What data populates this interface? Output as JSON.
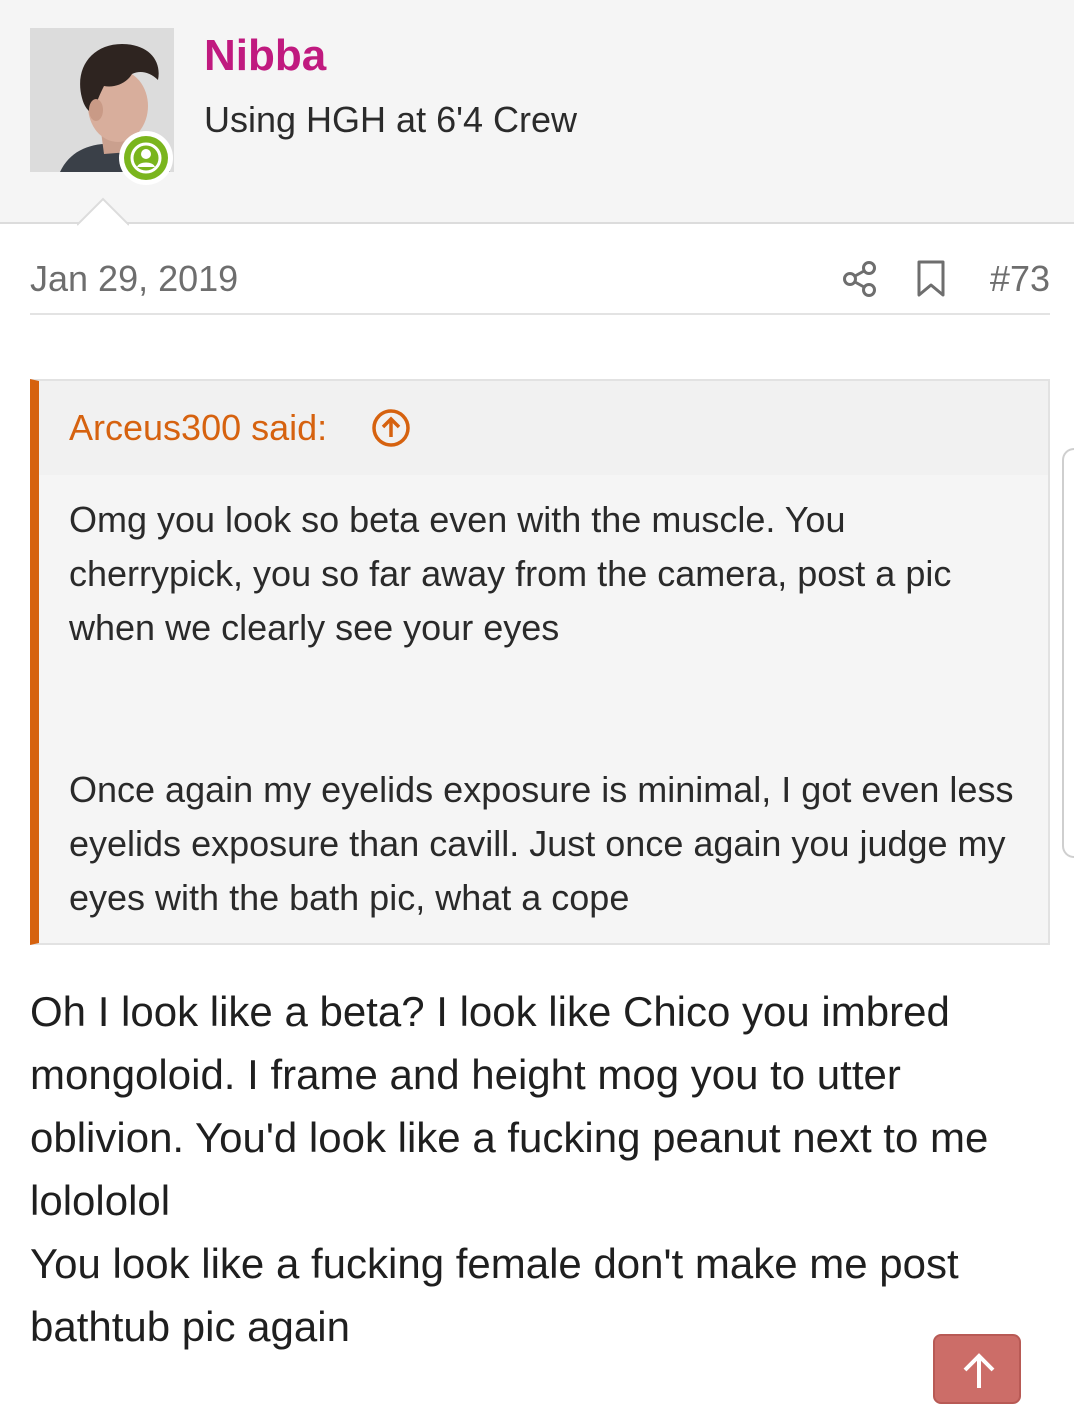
{
  "author": {
    "username": "Nibba",
    "user_title": "Using HGH at 6'4 Crew",
    "avatar_icon": "avatar-photo",
    "online_icon": "user-online-icon",
    "username_color": "#c01a7f",
    "online_color": "#7ab51d"
  },
  "post_meta": {
    "date": "Jan 29, 2019",
    "share_icon": "share-icon",
    "bookmark_icon": "bookmark-icon",
    "post_number": "#73"
  },
  "quote": {
    "author_label": "Arceus300 said:",
    "jump_icon": "arrow-up-circle-icon",
    "accent_color": "#d6620f",
    "paragraphs": [
      "Omg you look so beta even with the muscle. You cherrypick, you so far away from the camera, post a pic when we clearly see your eyes",
      "Once again my eyelids exposure is minimal, I got even less eyelids exposure than cavill. Just once again you judge my eyes with the bath pic, what a cope"
    ]
  },
  "post_body": {
    "paragraphs": [
      "Oh I look like a beta? I look like Chico you imbred mongoloid. I frame and height mog you to utter oblivion. You'd look like a fucking peanut next to me lolololol",
      "You look like a fucking female don't make me post bathtub pic again"
    ]
  },
  "scroll_top_button": {
    "icon": "arrow-up-icon",
    "color": "#cc6d68"
  }
}
